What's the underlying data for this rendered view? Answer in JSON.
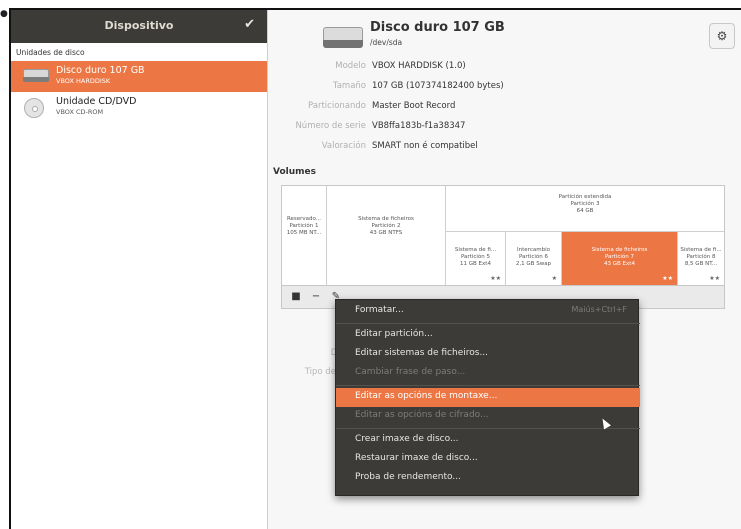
{
  "sidebar": {
    "title": "Dispositivo",
    "section_label": "Unidades de disco",
    "disks": [
      {
        "name": "Disco duro 107 GB",
        "sub": "VBOX HARDDISK",
        "selected": true
      },
      {
        "name": "Unidade CD/DVD",
        "sub": "VBOX CD-ROM",
        "selected": false
      }
    ]
  },
  "header": {
    "title": "Disco duro 107 GB",
    "path": "/dev/sda"
  },
  "properties": [
    {
      "key": "Modelo",
      "value": "VBOX HARDDISK (1.0)"
    },
    {
      "key": "Tamaño",
      "value": "107 GB (107374182400 bytes)"
    },
    {
      "key": "Particionando",
      "value": "Master Boot Record"
    },
    {
      "key": "Número de serie",
      "value": "VB8ffa183b-f1a38347"
    },
    {
      "key": "Valoración",
      "value": "SMART non é compatibel"
    }
  ],
  "volumes": {
    "label": "Volumes",
    "extended": {
      "l1": "Partición estendida",
      "l2": "Partición 3",
      "l3": "64 GB"
    },
    "top_partitions": [
      {
        "l1": "Reservado...",
        "l2": "Partición 1",
        "l3": "105 MB NT..."
      },
      {
        "l1": "Sistema de ficheiros",
        "l2": "Partición 2",
        "l3": "43 GB NTFS"
      }
    ],
    "sub_partitions": [
      {
        "l1": "Sistema de fi...",
        "l2": "Partición 5",
        "l3": "11 GB Ext4",
        "selected": false
      },
      {
        "l1": "Intercambio",
        "l2": "Partición 6",
        "l3": "2,1 GB Swap",
        "selected": false
      },
      {
        "l1": "Sistema de ficheiros",
        "l2": "Partición 7",
        "l3": "43 GB Ext4",
        "selected": true
      },
      {
        "l1": "Sistema de fi...",
        "l2": "Partición 8",
        "l3": "8,5 GB NT...",
        "selected": false
      }
    ]
  },
  "details_dim": {
    "disp": "Dis",
    "tipo": "Tipo de p",
    "c": "C"
  },
  "menu": {
    "items": [
      {
        "label": "Formatar...",
        "accel": "Maiús+Ctrl+F",
        "disabled": false,
        "highlight": false
      },
      {
        "label": "Editar partición...",
        "accel": "",
        "disabled": false,
        "highlight": false
      },
      {
        "label": "Editar sistemas de ficheiros...",
        "accel": "",
        "disabled": false,
        "highlight": false
      },
      {
        "label": "Cambiar frase de paso...",
        "accel": "",
        "disabled": true,
        "highlight": false
      },
      {
        "label": "Editar as opcións de montaxe...",
        "accel": "",
        "disabled": false,
        "highlight": true
      },
      {
        "label": "Editar as opcións de cifrado...",
        "accel": "",
        "disabled": true,
        "highlight": false
      },
      {
        "label": "Crear imaxe de disco...",
        "accel": "",
        "disabled": false,
        "highlight": false
      },
      {
        "label": "Restaurar imaxe de disco...",
        "accel": "",
        "disabled": false,
        "highlight": false
      },
      {
        "label": "Proba de rendemento...",
        "accel": "",
        "disabled": false,
        "highlight": false
      }
    ]
  },
  "icons": {
    "check": "checkmark-icon",
    "gear": "gear-icon",
    "stop": "stop-icon",
    "remove": "minus-icon",
    "settings": "wrench-icon"
  },
  "colors": {
    "accent": "#ec7744",
    "header_bg": "#3c3b37",
    "menu_bg": "#3d3b37"
  }
}
